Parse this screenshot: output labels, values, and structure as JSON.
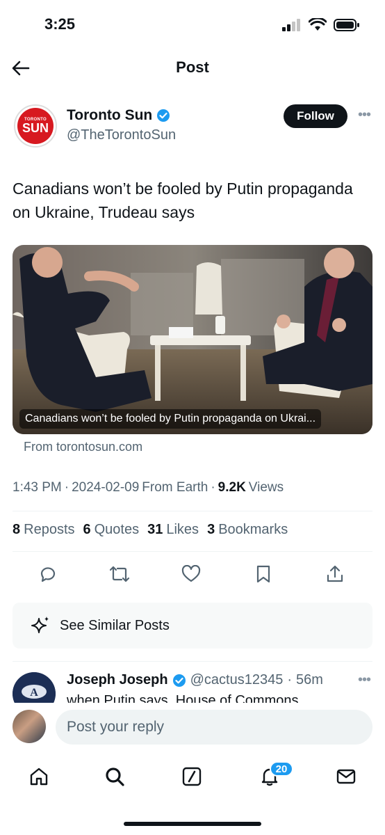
{
  "status": {
    "time": "3:25"
  },
  "header": {
    "title": "Post"
  },
  "post": {
    "author_name": "Toronto Sun",
    "author_handle": "@TheTorontoSun",
    "avatar_small_text": "TORONTO",
    "avatar_big_text": "SUN",
    "follow_label": "Follow",
    "text": "Canadians won’t be fooled by Putin propaganda on Ukraine, Trudeau says",
    "card_caption": "Canadians won’t be fooled by Putin propaganda on Ukrai...",
    "card_source": "From torontosun.com",
    "time": "1:43 PM",
    "date": "2024-02-09",
    "location": "From Earth",
    "views_count": "9.2K",
    "views_label": "Views",
    "stats": [
      {
        "count": "8",
        "label": "Reposts"
      },
      {
        "count": "6",
        "label": "Quotes"
      },
      {
        "count": "31",
        "label": "Likes"
      },
      {
        "count": "3",
        "label": "Bookmarks"
      }
    ]
  },
  "similar": {
    "label": "See Similar Posts"
  },
  "reply": {
    "name": "Joseph Joseph",
    "handle": "@cactus12345",
    "age": "56m",
    "text": "when Putin says, House of Commons"
  },
  "composer": {
    "placeholder": "Post your reply"
  },
  "tabbar": {
    "notification_badge": "20"
  },
  "colors": {
    "accent": "#1d9bf0",
    "brand_red": "#d71920",
    "text": "#0f1419",
    "muted": "#536471"
  },
  "icons": [
    "back-arrow-icon",
    "verified-icon",
    "more-icon",
    "reply-icon",
    "repost-icon",
    "like-icon",
    "bookmark-icon",
    "share-icon",
    "sparkle-icon",
    "home-icon",
    "search-icon",
    "grok-icon",
    "bell-icon",
    "mail-icon"
  ]
}
